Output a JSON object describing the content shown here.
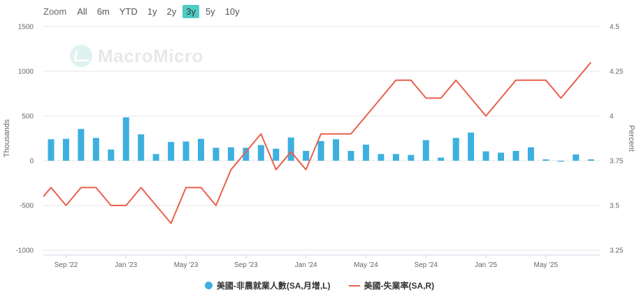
{
  "zoom": {
    "label": "Zoom",
    "buttons": [
      "All",
      "6m",
      "YTD",
      "1y",
      "2y",
      "3y",
      "5y",
      "10y"
    ],
    "active": "3y"
  },
  "watermark": {
    "text": "MacroMicro"
  },
  "legend": {
    "series1": "美國-非農就業人數(SA,月增,L)",
    "series2": "美國-失業率(SA,R)"
  },
  "colors": {
    "bars": "#3db0e0",
    "line": "#e8604c",
    "zoom_active": "#4ecdc4"
  },
  "chart_data": {
    "type": "bar+line",
    "months": [
      "2022-08",
      "2022-09",
      "2022-10",
      "2022-11",
      "2022-12",
      "2023-01",
      "2023-02",
      "2023-03",
      "2023-04",
      "2023-05",
      "2023-06",
      "2023-07",
      "2023-08",
      "2023-09",
      "2023-10",
      "2023-11",
      "2023-12",
      "2024-01",
      "2024-02",
      "2024-03",
      "2024-04",
      "2024-05",
      "2024-06",
      "2024-07",
      "2024-08",
      "2024-09",
      "2024-10",
      "2024-11",
      "2024-12",
      "2025-01",
      "2025-02",
      "2025-03",
      "2025-04",
      "2025-05",
      "2025-06",
      "2025-07",
      "2025-08",
      "2025-09"
    ],
    "x_tick_labels": [
      {
        "month": "2022-09",
        "label": "Sep '22"
      },
      {
        "month": "2023-01",
        "label": "Jan '23"
      },
      {
        "month": "2023-05",
        "label": "May '23"
      },
      {
        "month": "2023-09",
        "label": "Sep '23"
      },
      {
        "month": "2024-01",
        "label": "Jan '24"
      },
      {
        "month": "2024-05",
        "label": "May '24"
      },
      {
        "month": "2024-09",
        "label": "Sep '24"
      },
      {
        "month": "2025-01",
        "label": "Jan '25"
      },
      {
        "month": "2025-05",
        "label": "May '25"
      }
    ],
    "series": [
      {
        "name": "美國-非農就業人數(SA,月增,L)",
        "type": "bar",
        "axis": "left",
        "values": [
          240,
          245,
          355,
          255,
          125,
          485,
          295,
          75,
          210,
          215,
          245,
          145,
          150,
          145,
          175,
          135,
          260,
          110,
          220,
          240,
          110,
          180,
          75,
          75,
          65,
          230,
          35,
          255,
          315,
          105,
          90,
          110,
          150,
          15,
          -10,
          70,
          15,
          null
        ]
      },
      {
        "name": "美國-失業率(SA,R)",
        "type": "line",
        "axis": "right",
        "values": [
          3.6,
          3.5,
          3.6,
          3.6,
          3.5,
          3.5,
          3.6,
          3.5,
          3.4,
          3.6,
          3.6,
          3.5,
          3.7,
          3.8,
          3.9,
          3.7,
          3.8,
          3.7,
          3.9,
          3.9,
          3.9,
          4.0,
          4.1,
          4.2,
          4.2,
          4.1,
          4.1,
          4.2,
          4.1,
          4.0,
          4.1,
          4.2,
          4.2,
          4.2,
          4.1,
          4.2,
          4.3,
          null
        ],
        "start_value": 3.55
      }
    ],
    "left_axis": {
      "title": "Thousands",
      "range": [
        -1000,
        1500
      ],
      "ticks": [
        -1000,
        -500,
        0,
        500,
        1000,
        1500
      ]
    },
    "right_axis": {
      "title": "Percent",
      "range": [
        3.25,
        4.5
      ],
      "ticks": [
        3.25,
        3.5,
        3.75,
        4,
        4.25,
        4.5
      ],
      "tick_labels": [
        "3.25",
        "3.5",
        "3.75",
        "4",
        "4.25",
        "4.5"
      ]
    },
    "grid": true,
    "legend_position": "bottom-center"
  }
}
